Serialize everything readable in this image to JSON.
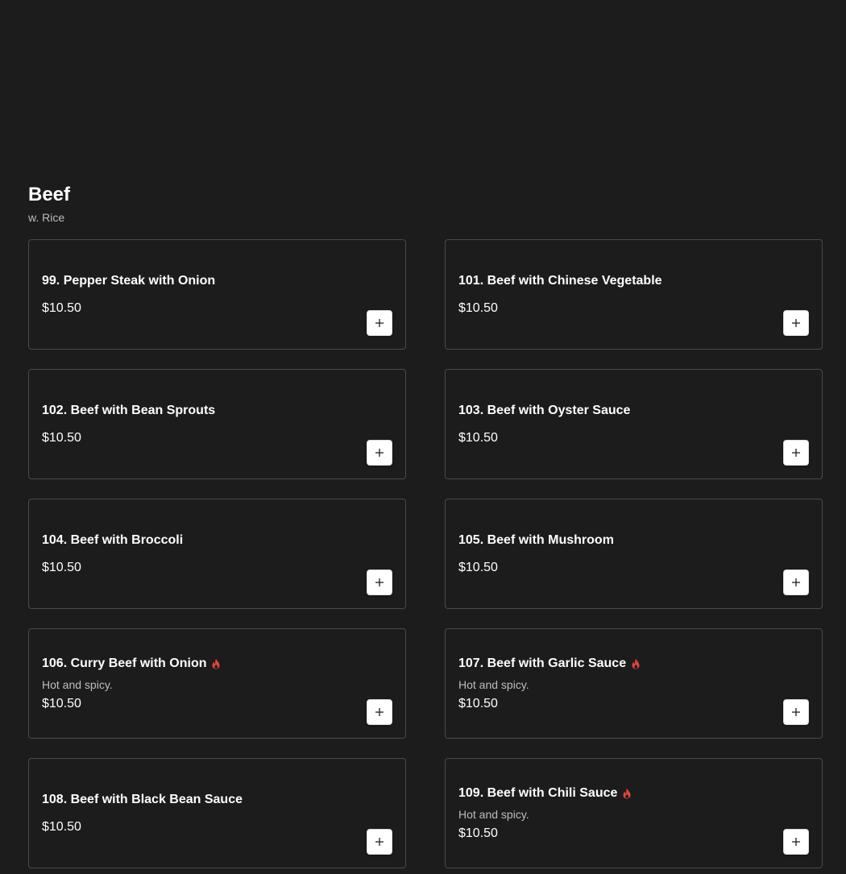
{
  "section": {
    "title": "Beef",
    "subtitle": "w. Rice"
  },
  "colors": {
    "background": "#1c1c1c",
    "card_border": "#4a4a4a",
    "spicy": "#e0463e",
    "add_button_bg": "#ffffff"
  },
  "items": [
    {
      "name": "99. Pepper Steak with Onion",
      "price": "$10.50",
      "spicy": false,
      "description": ""
    },
    {
      "name": "101. Beef with Chinese Vegetable",
      "price": "$10.50",
      "spicy": false,
      "description": ""
    },
    {
      "name": "102. Beef with Bean Sprouts",
      "price": "$10.50",
      "spicy": false,
      "description": ""
    },
    {
      "name": "103. Beef with Oyster Sauce",
      "price": "$10.50",
      "spicy": false,
      "description": ""
    },
    {
      "name": "104. Beef with Broccoli",
      "price": "$10.50",
      "spicy": false,
      "description": ""
    },
    {
      "name": "105. Beef with Mushroom",
      "price": "$10.50",
      "spicy": false,
      "description": ""
    },
    {
      "name": "106. Curry Beef with Onion",
      "price": "$10.50",
      "spicy": true,
      "description": "Hot and spicy."
    },
    {
      "name": "107. Beef with Garlic Sauce",
      "price": "$10.50",
      "spicy": true,
      "description": "Hot and spicy."
    },
    {
      "name": "108. Beef with Black Bean Sauce",
      "price": "$10.50",
      "spicy": false,
      "description": ""
    },
    {
      "name": "109. Beef with Chili Sauce",
      "price": "$10.50",
      "spicy": true,
      "description": "Hot and spicy."
    }
  ],
  "icons": {
    "spicy": "flame-icon",
    "add": "plus-icon"
  }
}
